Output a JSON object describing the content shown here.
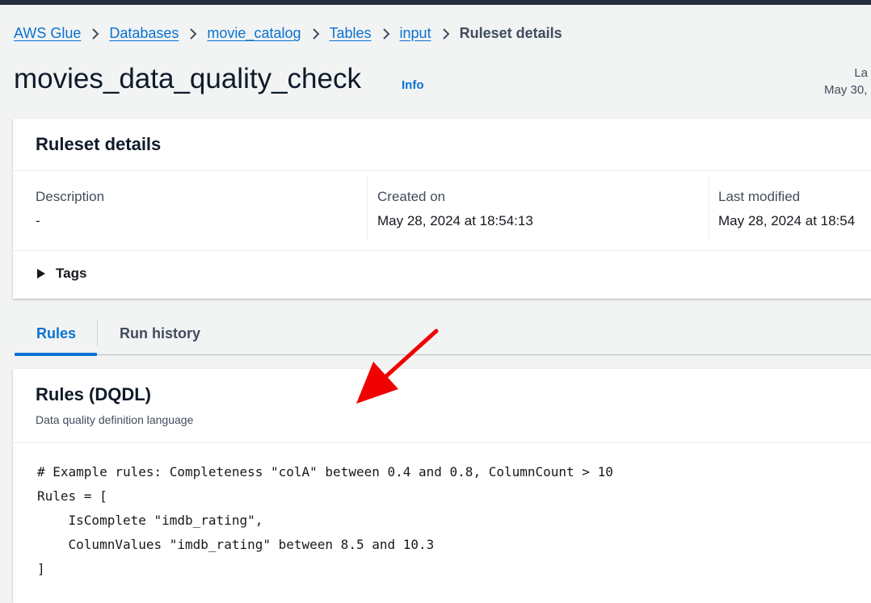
{
  "breadcrumb": {
    "items": [
      "AWS Glue",
      "Databases",
      "movie_catalog",
      "Tables",
      "input"
    ],
    "current": "Ruleset details"
  },
  "header": {
    "title": "movies_data_quality_check",
    "info_label": "Info",
    "right_label_partial": "La",
    "right_date_partial": "May 30,"
  },
  "details": {
    "title": "Ruleset details",
    "description_label": "Description",
    "description_value": "-",
    "created_label": "Created on",
    "created_value": "May 28, 2024 at 18:54:13",
    "modified_label": "Last modified",
    "modified_value": "May 28, 2024 at 18:54",
    "tags_label": "Tags"
  },
  "tabs": {
    "rules": "Rules",
    "run_history": "Run history",
    "active": "Rules"
  },
  "rules": {
    "title": "Rules (DQDL)",
    "subtitle": "Data quality definition language",
    "code_lines": [
      "# Example rules: Completeness \"colA\" between 0.4 and 0.8, ColumnCount > 10",
      "Rules = [",
      "    IsComplete \"imdb_rating\",",
      "    ColumnValues \"imdb_rating\" between 8.5 and 10.3",
      "]"
    ]
  },
  "colors": {
    "link": "#0972d3",
    "annotation_arrow": "#f00000",
    "top_bar": "#232f3e"
  },
  "icons": {
    "breadcrumb_separator": "chevron-right-icon",
    "tags_toggle": "caret-right-icon",
    "annotation": "red-arrow-icon"
  }
}
